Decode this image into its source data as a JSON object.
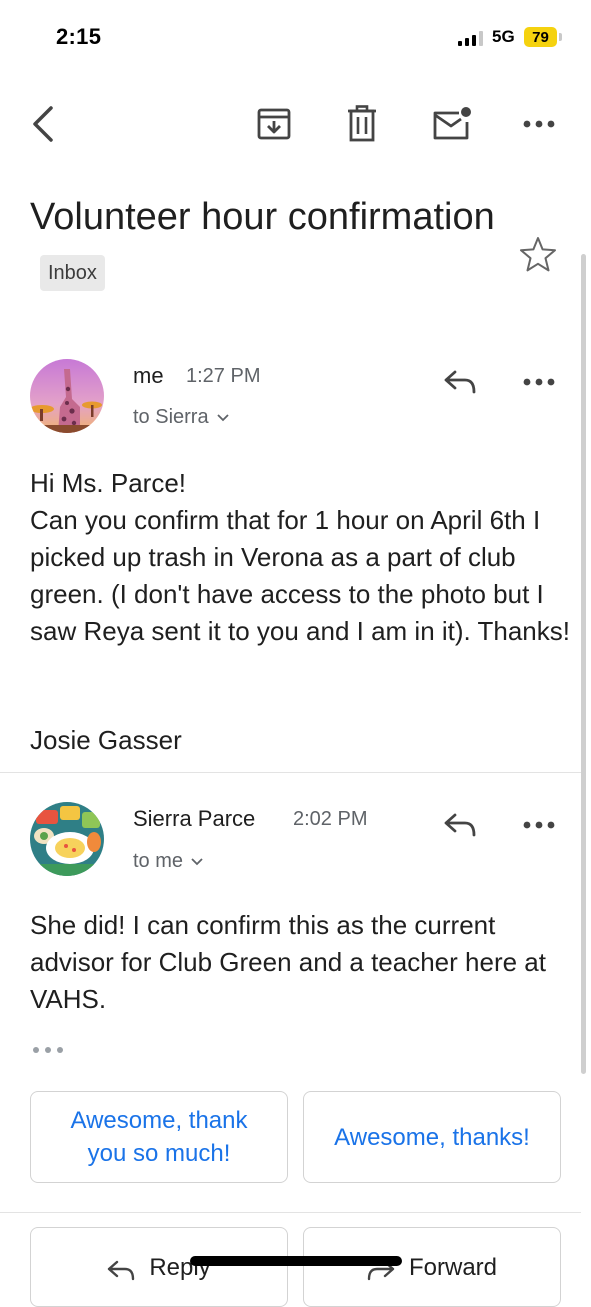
{
  "status_bar": {
    "time": "2:15",
    "network": "5G",
    "battery": "79"
  },
  "toolbar": {
    "back_icon": "back-arrow-icon",
    "archive_icon": "archive-icon",
    "delete_icon": "trash-icon",
    "unread_icon": "mark-unread-icon",
    "more_icon": "more-horizontal-icon"
  },
  "thread": {
    "subject": "Volunteer hour confirmation",
    "label": "Inbox"
  },
  "messages": [
    {
      "sender": "me",
      "time": "1:27 PM",
      "recipient": "to Sierra",
      "body": "Hi Ms. Parce!\nCan you confirm that for 1 hour on April 6th I picked up trash in Verona as a part of club green. (I don't have access to the photo but I saw Reya sent it to you and I am in it). Thanks!",
      "signature": "Josie Gasser"
    },
    {
      "sender": "Sierra Parce",
      "time": "2:02 PM",
      "recipient": "to me",
      "body": "She did! I can confirm this as the current advisor for Club Green and a teacher here at VAHS."
    }
  ],
  "smart_replies": [
    "Awesome, thank you so much!",
    "Awesome, thanks!"
  ],
  "actions": {
    "reply": "Reply",
    "forward": "Forward"
  },
  "colors": {
    "accent": "#1a73e8",
    "battery": "#f5d20f",
    "chip_bg": "#e9e9e9"
  }
}
